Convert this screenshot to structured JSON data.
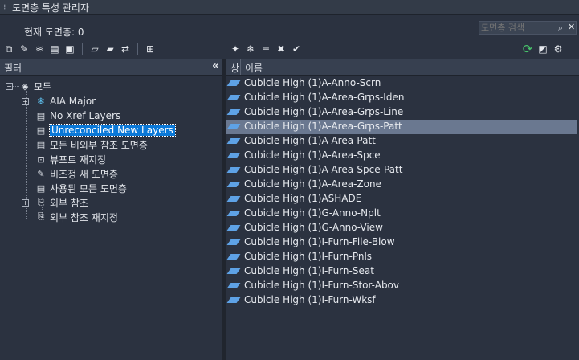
{
  "title": "도면층 특성 관리자",
  "current_layer": "현재 도면층: 0",
  "search": {
    "placeholder": "도면층 검색"
  },
  "filter_panel": {
    "header": "필터",
    "tree": [
      {
        "label": "모두",
        "icon": "layers-all-icon"
      },
      {
        "label": "AIA Major",
        "icon": "snowflake-filter-icon"
      },
      {
        "label": "No Xref Layers",
        "icon": "filter-icon"
      },
      {
        "label": "Unreconciled New Layers",
        "icon": "filter-icon"
      },
      {
        "label": "모든 비외부 참조 도면층",
        "icon": "filter-icon"
      },
      {
        "label": "뷰포트 재지정",
        "icon": "viewport-override-icon"
      },
      {
        "label": "비조정 새 도면층",
        "icon": "unreconciled-icon"
      },
      {
        "label": "사용된 모든 도면층",
        "icon": "filter-icon"
      },
      {
        "label": "외부 참조",
        "icon": "xref-icon"
      },
      {
        "label": "외부 참조 재지정",
        "icon": "xref-override-icon"
      }
    ]
  },
  "layer_list": {
    "columns": [
      "상",
      "이름"
    ],
    "rows": [
      "Cubicle High (1)A-Anno-Scrn",
      "Cubicle High (1)A-Area-Grps-Iden",
      "Cubicle High (1)A-Area-Grps-Line",
      "Cubicle High (1)A-Area-Grps-Patt",
      "Cubicle High (1)A-Area-Patt",
      "Cubicle High (1)A-Area-Spce",
      "Cubicle High (1)A-Area-Spce-Patt",
      "Cubicle High (1)A-Area-Zone",
      "Cubicle High (1)ASHADE",
      "Cubicle High (1)G-Anno-Nplt",
      "Cubicle High (1)G-Anno-View",
      "Cubicle High (1)I-Furn-File-Blow",
      "Cubicle High (1)I-Furn-Pnls",
      "Cubicle High (1)I-Furn-Seat",
      "Cubicle High (1)I-Furn-Stor-Abov",
      "Cubicle High (1)I-Furn-Wksf"
    ],
    "selected_index": 3
  },
  "icons": {
    "left_toolbar": [
      "new-property-filter-icon",
      "new-group-filter-icon",
      "layer-states-icon",
      "layer-settings-icon",
      "save-icon",
      "folder-open-icon",
      "folder-icon",
      "import-icon",
      "export-icon"
    ],
    "right_toolbar": [
      "new-layer-icon",
      "new-vp-frozen-layer-icon",
      "delete-layer-icon",
      "set-current-icon",
      "refresh-icon",
      "settings-icon",
      "gear-icon"
    ]
  },
  "colors": {
    "accent": "#0a78d7",
    "row_selected": "#6a7890",
    "refresh": "#47c26a"
  }
}
